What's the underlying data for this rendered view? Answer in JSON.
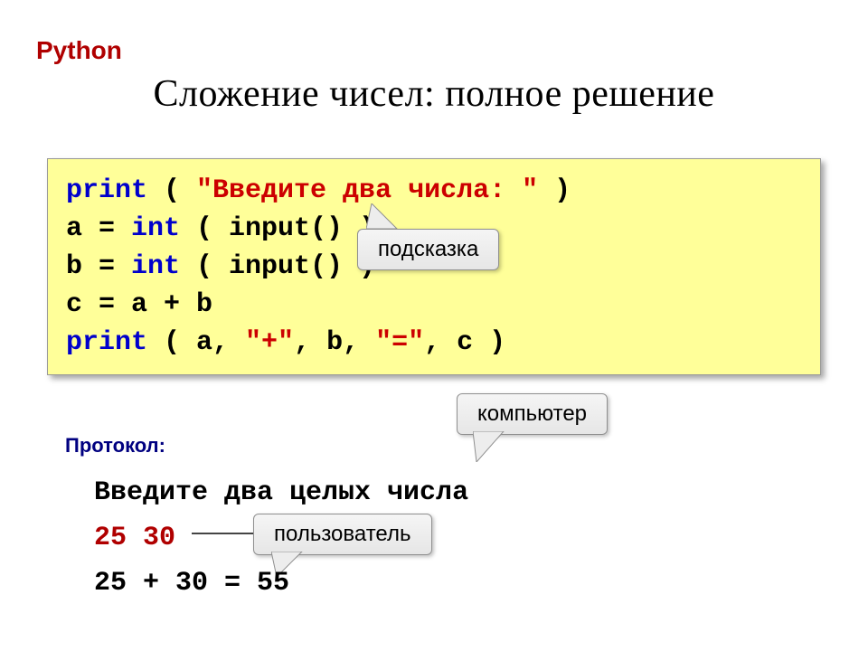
{
  "header": {
    "lang": "Python",
    "title": "Сложение чисел: полное решение"
  },
  "code": {
    "l1_kw": "print",
    "l1_rest_a": " ( ",
    "l1_str": "\"Введите два числа: \"",
    "l1_rest_b": " )",
    "l2_a": "a = ",
    "l2_kw": "int",
    "l2_b": " ( input() )",
    "l3_a": "b = ",
    "l3_kw": "int",
    "l3_b": " ( input() )",
    "l4": "c = a + b",
    "l5_kw": "print",
    "l5_a": " ( a, ",
    "l5_s1": "\"+\"",
    "l5_b": ", b, ",
    "l5_s2": "\"=\"",
    "l5_c": ", c )"
  },
  "tags": {
    "hint": "подсказка",
    "computer": "компьютер",
    "user": "пользователь"
  },
  "protocol": {
    "label": "Протокол:",
    "line1": "Введите два целых числа",
    "line2": "25 30",
    "line3": "25 + 30 = 55"
  }
}
